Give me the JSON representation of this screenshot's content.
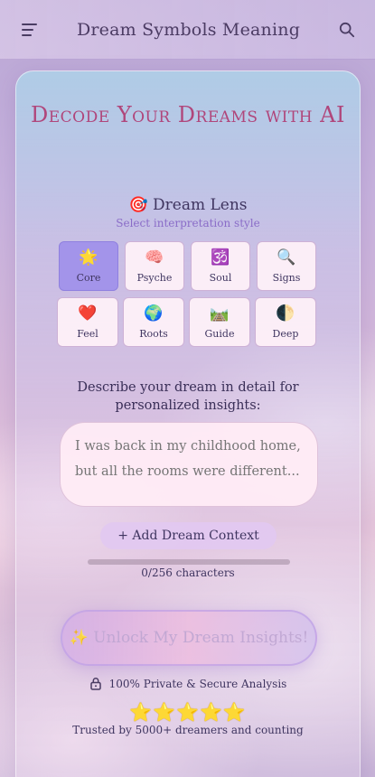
{
  "header": {
    "title": "Dream Symbols Meaning",
    "menu_icon": "hamburger-menu-icon",
    "search_icon": "search-icon"
  },
  "hero": {
    "title": "Decode Your Dreams with AI"
  },
  "lens": {
    "icon": "🎯",
    "title": "Dream Lens",
    "subtitle": "Select interpretation style",
    "options": [
      {
        "emoji": "🌟",
        "label": "Core",
        "active": true
      },
      {
        "emoji": "🧠",
        "label": "Psyche",
        "active": false
      },
      {
        "emoji": "🕉️",
        "label": "Soul",
        "active": false
      },
      {
        "emoji": "🔍",
        "label": "Signs",
        "active": false
      },
      {
        "emoji": "❤️",
        "label": "Feel",
        "active": false
      },
      {
        "emoji": "🌍",
        "label": "Roots",
        "active": false
      },
      {
        "emoji": "🛤️",
        "label": "Guide",
        "active": false
      },
      {
        "emoji": "🌓",
        "label": "Deep",
        "active": false
      }
    ]
  },
  "form": {
    "describe_label": "Describe your dream in detail for personalized insights:",
    "placeholder": "I was back in my childhood home, but all the rooms were different...",
    "value": "",
    "add_context_label": "+ Add Dream Context",
    "char_count": "0/256 characters",
    "char_progress": 0,
    "submit_label": "✨ Unlock My Dream Insights!"
  },
  "footer": {
    "privacy_text": "100% Private & Secure Analysis",
    "stars": "⭐⭐⭐⭐⭐",
    "rating": 5,
    "trusted_text": "Trusted by 5000+ dreamers and counting"
  },
  "colors": {
    "accent": "#b0467b",
    "active_tile": "#a394ea",
    "text": "#3f3560"
  }
}
